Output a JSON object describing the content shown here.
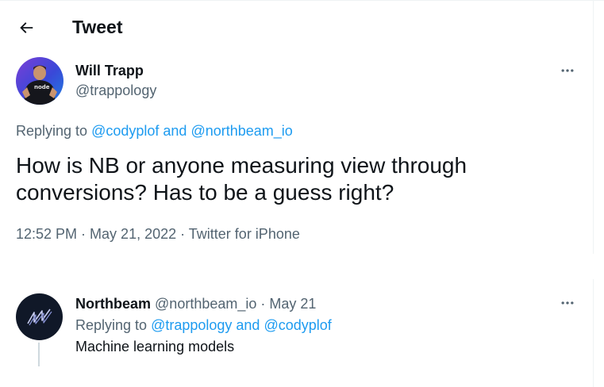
{
  "header": {
    "title": "Tweet",
    "back_icon": "arrow-left-icon"
  },
  "tweet": {
    "author": {
      "name": "Will Trapp",
      "handle": "@trappology",
      "avatar_shirt_text": "node"
    },
    "replying": {
      "prefix": "Replying to ",
      "mention1": "@codyplof",
      "conj": " and ",
      "mention2": "@northbeam_io"
    },
    "text": "How is NB or anyone measuring view through conversions? Has to be a guess right?",
    "time": "12:52 PM",
    "sep": " · ",
    "date": "May 21, 2022",
    "source": "Twitter for iPhone",
    "more_icon": "more-horizontal-icon"
  },
  "reply": {
    "author": {
      "name": "Northbeam",
      "handle": "@northbeam_io",
      "date": "May 21"
    },
    "sep": " · ",
    "replying": {
      "prefix": "Replying to ",
      "mention1": "@trappology",
      "conj": " and ",
      "mention2": "@codyplof"
    },
    "text": "Machine learning models",
    "more_icon": "more-horizontal-icon"
  },
  "colors": {
    "link": "#1d9bf0",
    "secondary_text": "#536471",
    "primary_text": "#0f1419",
    "northbeam_avatar_bg": "#101828"
  }
}
